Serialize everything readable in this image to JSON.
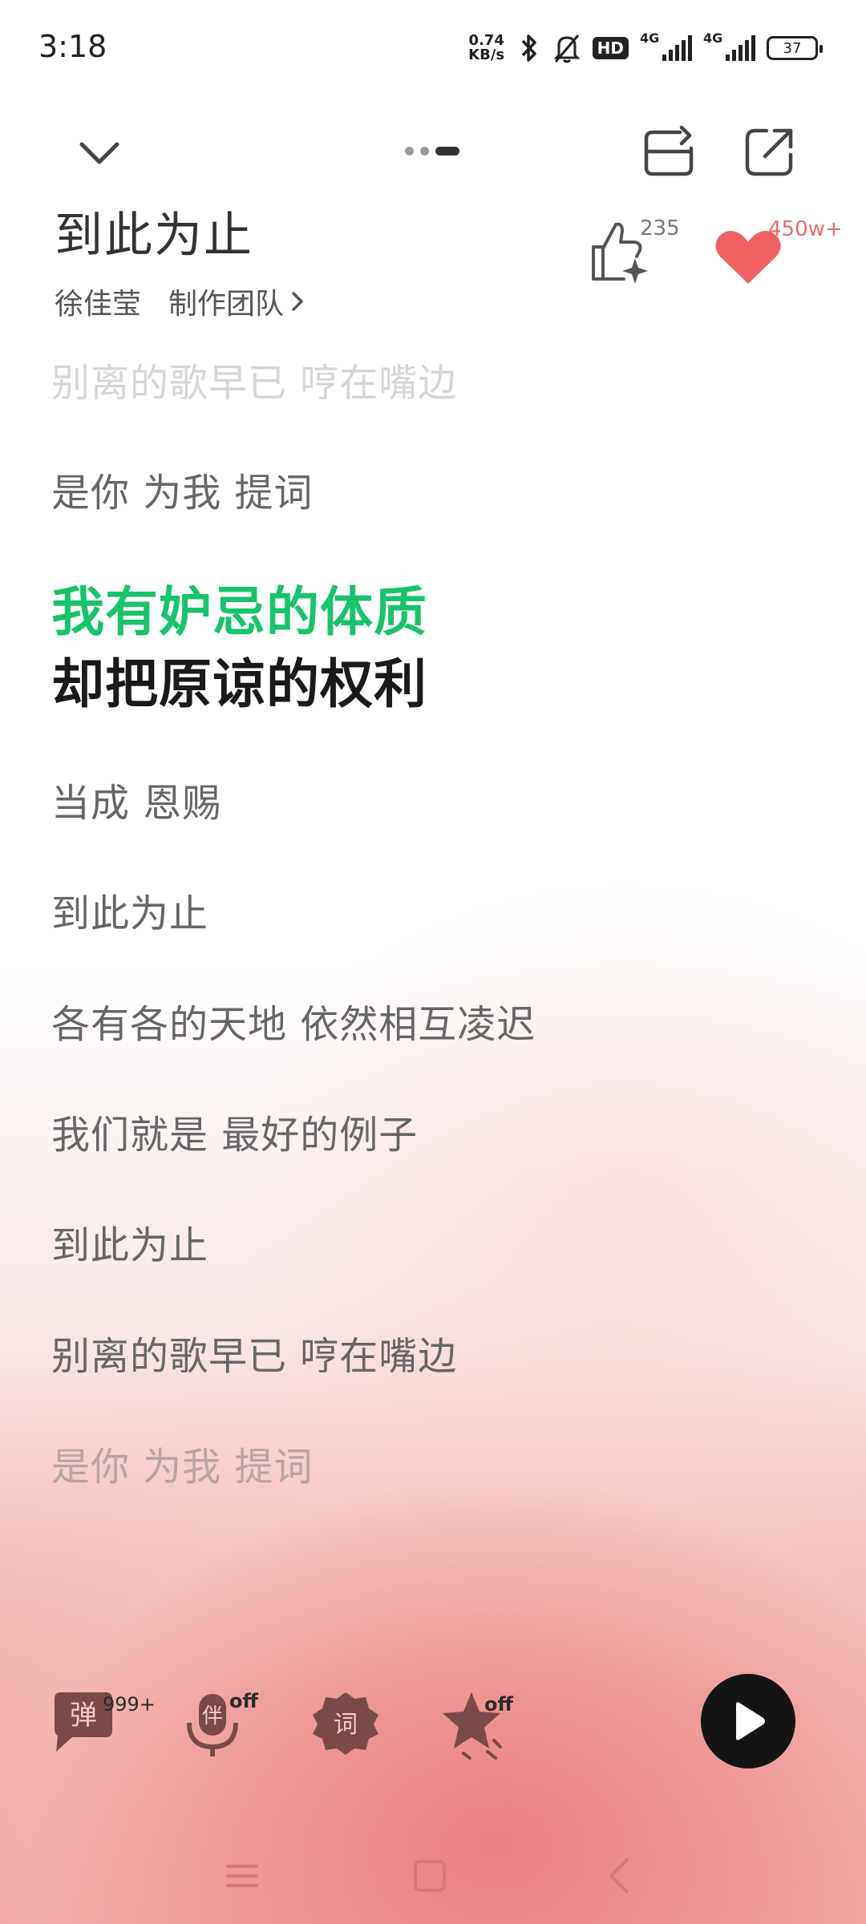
{
  "status_bar": {
    "time": "3:18",
    "net_speed_value": "0.74",
    "net_speed_unit": "KB/s",
    "hd_label": "HD",
    "network_1": "4G",
    "network_2": "4G",
    "battery": "37"
  },
  "header": {
    "title": "到此为止",
    "artist": "徐佳莹",
    "credits_label": "制作团队",
    "like_count": "235",
    "favorite_count": "450w+",
    "pager_active_index": 2
  },
  "lyrics": [
    {
      "text": "别离的歌早已 哼在嘴边",
      "state": "faded"
    },
    {
      "text": "是你 为我 提词",
      "state": "normal"
    },
    {
      "text": "我有妒忌的体质",
      "state": "active"
    },
    {
      "text": "却把原谅的权利",
      "state": "next"
    },
    {
      "text": "当成 恩赐",
      "state": "normal"
    },
    {
      "text": "到此为止",
      "state": "normal"
    },
    {
      "text": "各有各的天地 依然相互凌迟",
      "state": "normal"
    },
    {
      "text": "我们就是 最好的例子",
      "state": "normal"
    },
    {
      "text": "到此为止",
      "state": "normal"
    },
    {
      "text": "别离的歌早已 哼在嘴边",
      "state": "normal"
    },
    {
      "text": "是你 为我 提词",
      "state": "faded"
    }
  ],
  "toolbar": {
    "danmu_label": "弹",
    "danmu_count": "999+",
    "accompany_label": "伴",
    "accompany_state": "off",
    "lyrics_label": "词",
    "effect_state": "off"
  },
  "colors": {
    "active_lyric": "#17c36b",
    "favorite": "#f06262",
    "play_button": "#151515"
  }
}
